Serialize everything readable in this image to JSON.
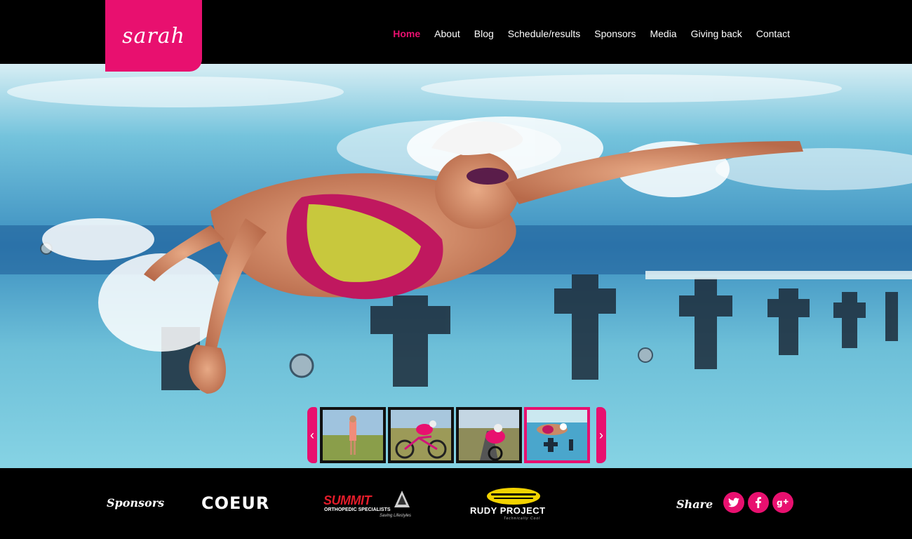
{
  "header": {
    "logo_text": "sarah",
    "nav": [
      {
        "label": "Home",
        "active": true
      },
      {
        "label": "About"
      },
      {
        "label": "Blog"
      },
      {
        "label": "Schedule/results"
      },
      {
        "label": "Sponsors"
      },
      {
        "label": "Media"
      },
      {
        "label": "Giving back"
      },
      {
        "label": "Contact"
      }
    ]
  },
  "hero": {
    "image": "swimmer-underwater",
    "carousel": {
      "prev_icon": "chevron-left-icon",
      "next_icon": "chevron-right-icon",
      "prev_glyph": "‹",
      "next_glyph": "›",
      "thumbnails": [
        {
          "name": "runner-field-thumb"
        },
        {
          "name": "cyclist-road-thumb"
        },
        {
          "name": "cyclist-aero-thumb"
        },
        {
          "name": "swimmer-pool-thumb",
          "active": true
        }
      ]
    }
  },
  "footer": {
    "sponsors_label": "Sponsors",
    "sponsors": {
      "coeur": "COEUR",
      "summit_name": "SUMMIT",
      "summit_sub": "ORTHOPEDIC SPECIALISTS",
      "summit_tag": "Saving Lifestyles",
      "rudy_name": "RUDY PROJECT",
      "rudy_tag": "Technically Cool"
    },
    "share_label": "Share",
    "social": [
      "twitter-icon",
      "facebook-icon",
      "google-plus-icon"
    ]
  },
  "colors": {
    "accent": "#e8106f",
    "background": "#000000"
  }
}
